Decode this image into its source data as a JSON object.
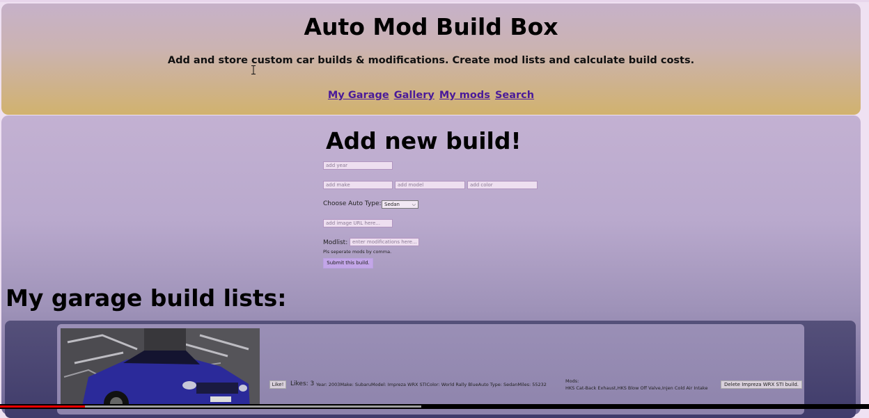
{
  "header": {
    "title": "Auto Mod Build Box",
    "subtitle": "Add and store custom car builds & modifications. Create mod lists and calculate build costs.",
    "nav": [
      "My Garage",
      "Gallery",
      "My mods",
      "Search"
    ]
  },
  "form": {
    "title": "Add new build!",
    "year_placeholder": "add year",
    "make_placeholder": "add make",
    "model_placeholder": "add model",
    "color_placeholder": "add color",
    "auto_type_label": "Choose Auto Type:",
    "auto_type_value": "Sedan",
    "image_placeholder": "add image URL here...",
    "modlist_label": "Modlist:",
    "modlist_placeholder": "enter modifications here...",
    "modlist_hint": "Pls seperate mods by comma.",
    "submit_label": "Submit this build."
  },
  "garage": {
    "title": "My garage build lists:",
    "builds": [
      {
        "like_label": "Like!",
        "likes_text": "Likes: 3",
        "details": "Year: 2003Make: SubaruModel: Impreza WRX STIColor: World Rally BlueAuto Type: SedanMiles: 55232",
        "mods_label": "Mods:",
        "mods": "HKS Cat-Back Exhaust,HKS Blow Off Valve,Injen Cold Air Intake",
        "delete_label": "Delete Impreza WRX STI build."
      }
    ]
  },
  "video": {
    "progress": 0.098,
    "buffered": 0.485
  },
  "colors": {
    "header_top": "#c6b1c9",
    "header_bottom": "#d1b26e",
    "nav_link": "#4a1a9a",
    "submit_button": "#c3a6e8",
    "car_blue": "#2b2a9a"
  }
}
